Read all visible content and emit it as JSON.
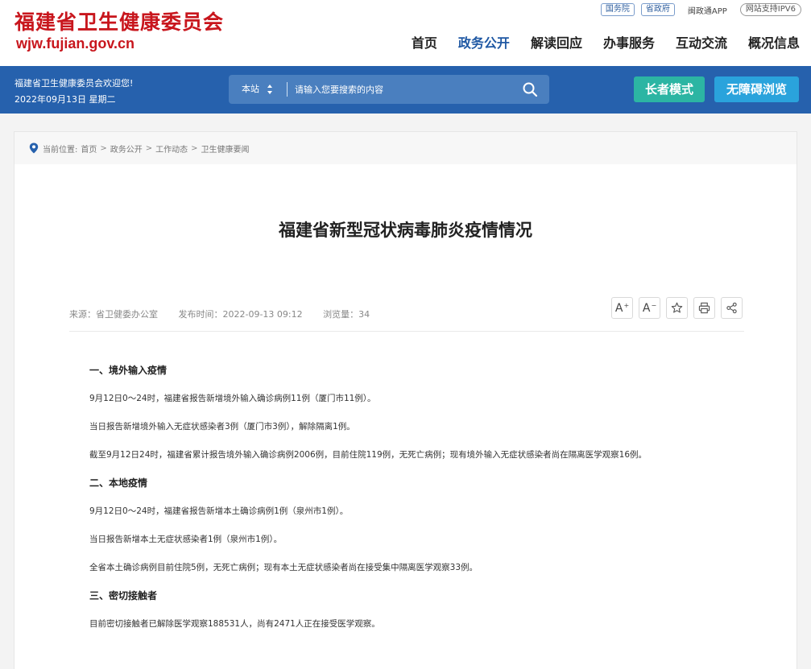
{
  "header": {
    "logo_cn": "福建省卫生健康委员会",
    "logo_url": "wjw.fujian.gov.cn",
    "top_links": {
      "state_council": "国务院",
      "provincial_gov": "省政府",
      "app": "闽政通APP",
      "ipv6": "网站支持IPV6"
    },
    "nav": [
      {
        "label": "首页"
      },
      {
        "label": "政务公开"
      },
      {
        "label": "解读回应"
      },
      {
        "label": "办事服务"
      },
      {
        "label": "互动交流"
      },
      {
        "label": "概况信息"
      }
    ]
  },
  "bluebar": {
    "welcome": "福建省卫生健康委员会欢迎您!",
    "date": "2022年09月13日 星期二",
    "search": {
      "scope": "本站",
      "placeholder": "请输入您要搜索的内容"
    },
    "elder_mode": "长者模式",
    "accessible": "无障碍浏览"
  },
  "breadcrumb": {
    "prefix": "当前位置:",
    "items": [
      "首页",
      "政务公开",
      "工作动态",
      "卫生健康要闻"
    ]
  },
  "article": {
    "title": "福建省新型冠状病毒肺炎疫情情况",
    "source": "来源：省卫健委办公室",
    "published": "发布时间：2022-09-13 09:12",
    "views": "浏览量：34",
    "tools": {
      "font_larger": "A",
      "font_smaller": "A"
    },
    "paragraphs": [
      {
        "type": "heading",
        "text": "一、境外输入疫情"
      },
      {
        "type": "text",
        "text": "9月12日0～24时，福建省报告新增境外输入确诊病例11例（厦门市11例）。"
      },
      {
        "type": "text",
        "text": "当日报告新增境外输入无症状感染者3例（厦门市3例），解除隔离1例。"
      },
      {
        "type": "text",
        "text": "截至9月12日24时，福建省累计报告境外输入确诊病例2006例，目前住院119例，无死亡病例；现有境外输入无症状感染者尚在隔离医学观察16例。"
      },
      {
        "type": "heading",
        "text": "二、本地疫情"
      },
      {
        "type": "text",
        "text": "9月12日0～24时，福建省报告新增本土确诊病例1例（泉州市1例）。"
      },
      {
        "type": "text",
        "text": "当日报告新增本土无症状感染者1例（泉州市1例）。"
      },
      {
        "type": "text",
        "text": "全省本土确诊病例目前住院5例，无死亡病例；现有本土无症状感染者尚在接受集中隔离医学观察33例。"
      },
      {
        "type": "heading",
        "text": "三、密切接触者"
      },
      {
        "type": "text",
        "text": "目前密切接触者已解除医学观察188531人，尚有2471人正在接受医学观察。"
      }
    ]
  },
  "colors": {
    "brand_red": "#c8161d",
    "bar_blue": "#2661ad",
    "nav_active": "#1f58a3",
    "elder_green": "#2cb5a3",
    "access_blue": "#2aa3dc"
  }
}
